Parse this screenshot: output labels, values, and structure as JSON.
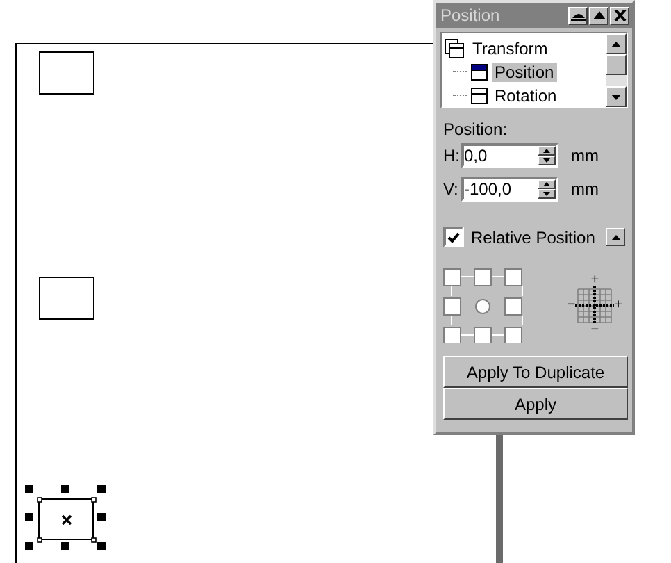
{
  "panel": {
    "title": "Position",
    "tree": {
      "label": "Transform",
      "children": [
        {
          "label": "Position",
          "selected": true
        },
        {
          "label": "Rotation",
          "selected": false
        }
      ]
    },
    "section_label": "Position:",
    "fields": [
      {
        "label": "H:",
        "value": "0,0",
        "unit": "mm"
      },
      {
        "label": "V:",
        "value": "-100,0",
        "unit": "mm"
      }
    ],
    "relative_position": {
      "label": "Relative Position",
      "checked": true
    },
    "ruler_signs": {
      "top": "+",
      "left": "−",
      "right": "+",
      "bottom": "−"
    },
    "buttons": [
      "Apply To Duplicate",
      "Apply"
    ]
  }
}
